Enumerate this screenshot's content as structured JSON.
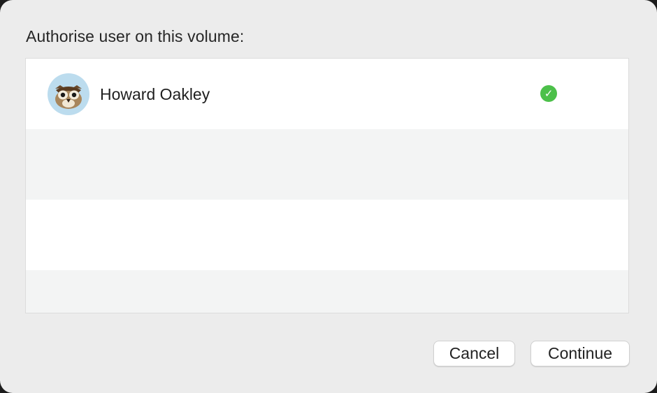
{
  "dialog": {
    "prompt": "Authorise user on this volume:"
  },
  "users": [
    {
      "name": "Howard Oakley",
      "avatar_icon": "owl-avatar-icon",
      "selected_icon": "checkmark-circle-icon",
      "selected": true
    }
  ],
  "buttons": {
    "cancel_label": "Cancel",
    "continue_label": "Continue"
  },
  "colors": {
    "dialog_background": "#ececec",
    "row_white": "#ffffff",
    "row_alternate": "#f3f4f4",
    "check_green": "#4cc04a",
    "avatar_background": "#bcdcee"
  }
}
